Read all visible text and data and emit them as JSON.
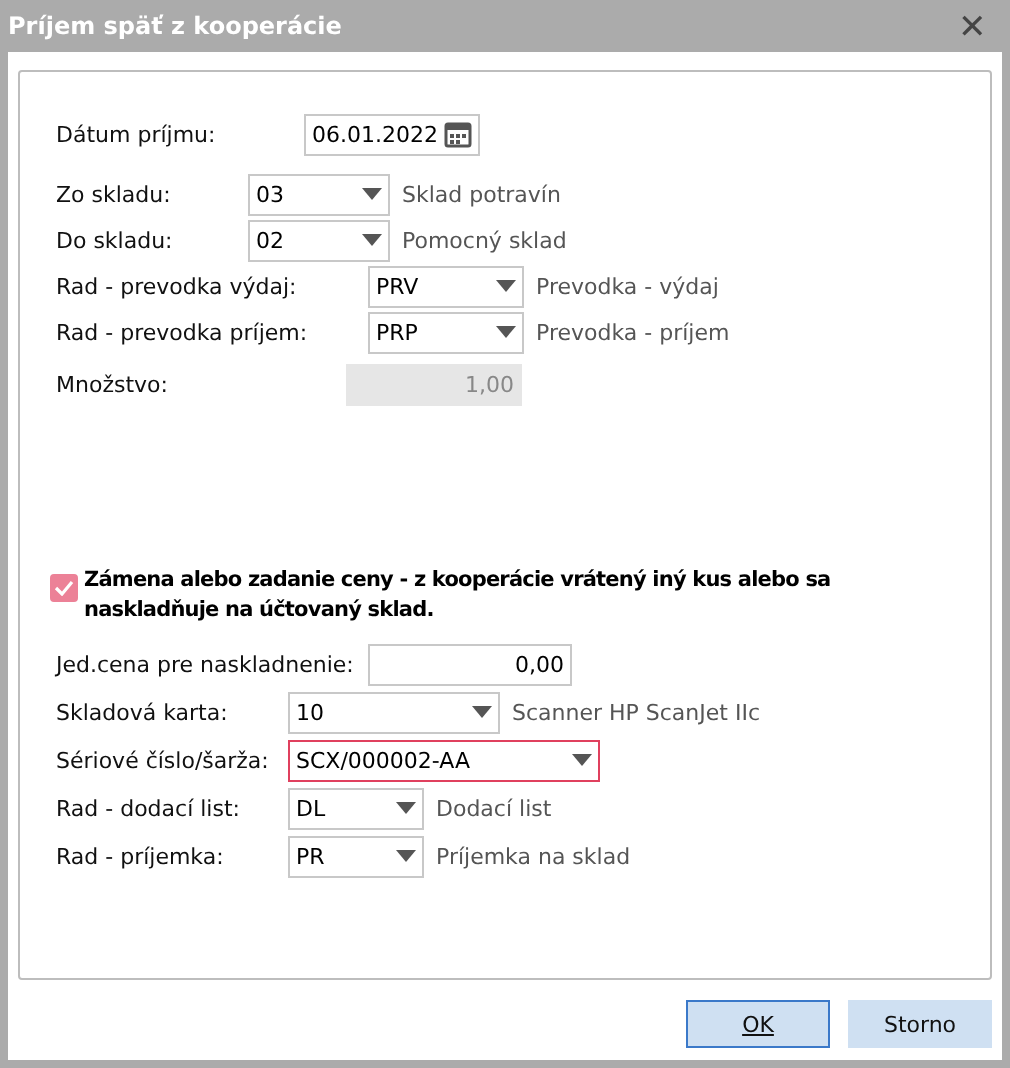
{
  "window": {
    "title": "Príjem späť z kooperácie",
    "close": "✕"
  },
  "top_fields": [
    {
      "label": "Dátum príjmu:",
      "kind": "date",
      "value": "06.01.2022"
    },
    {
      "label": "Zo skladu:",
      "kind": "combo",
      "value": "03",
      "description": "Sklad potravín"
    },
    {
      "label": "Do skladu:",
      "kind": "combo",
      "value": "02",
      "description": "Pomocný sklad"
    },
    {
      "label": "Rad - prevodka výdaj:",
      "kind": "combo",
      "value": "PRV",
      "description": "Prevodka - výdaj"
    },
    {
      "label": "Rad - prevodka príjem:",
      "kind": "combo",
      "value": "PRP",
      "description": "Prevodka - príjem"
    },
    {
      "label": "Množstvo:",
      "kind": "number",
      "value": "1,00",
      "disabled": true
    }
  ],
  "replacement": {
    "label": "Zámena alebo zadanie ceny - z kooperácie vrátený iný kus alebo sa naskladňuje na účtovaný sklad.",
    "checked": true
  },
  "bottom_fields": [
    {
      "label": "Jed.cena pre naskladnenie:",
      "kind": "number",
      "value": "0,00",
      "disabled": false
    },
    {
      "label": "Skladová karta:",
      "kind": "combo",
      "value": "10",
      "description": "Scanner HP ScanJet IIc"
    },
    {
      "label": "Sériové číslo/šarža:",
      "kind": "combo",
      "value": "SCX/000002-AA",
      "invalid": true
    },
    {
      "label": "Rad - dodací list:",
      "kind": "combo",
      "value": "DL",
      "description": "Dodací list"
    },
    {
      "label": "Rad - príjemka:",
      "kind": "combo",
      "value": "PR",
      "description": "Príjemka na sklad"
    }
  ],
  "buttons": [
    {
      "label": "OK",
      "default": true
    },
    {
      "label": "Storno",
      "default": false
    }
  ]
}
